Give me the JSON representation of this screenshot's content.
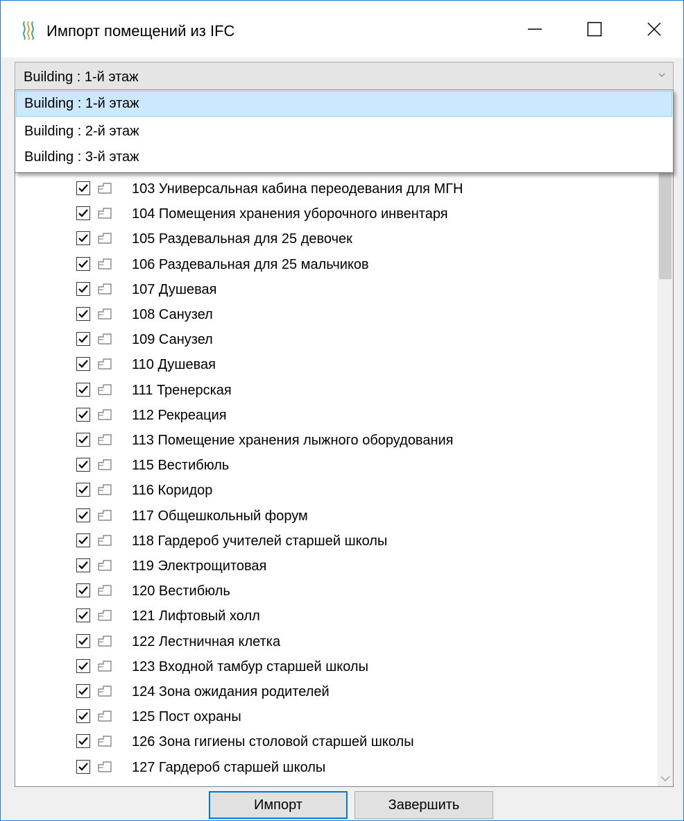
{
  "window": {
    "title": "Импорт помещений из IFC",
    "icons": {
      "app": "steam-waves-icon",
      "minimize": "minimize-icon",
      "maximize": "maximize-icon",
      "close": "close-icon"
    }
  },
  "level_select": {
    "value": "Building : 1-й этаж",
    "options": [
      "Building : 1-й этаж",
      "Building : 2-й этаж",
      "Building : 3-й этаж"
    ],
    "selected_index": 0
  },
  "rooms": [
    "103 Универсальная кабина переодевания для МГН",
    "104 Помещения хранения уборочного инвентаря",
    "105 Раздевальная для 25 девочек",
    "106 Раздевальная для 25 мальчиков",
    "107 Душевая",
    "108 Санузел",
    "109 Санузел",
    "110 Душевая",
    "111 Тренерская",
    "112 Рекреация",
    "113 Помещение хранения лыжного оборудования",
    "115 Вестибюль",
    "116 Коридор",
    "117 Общешкольный форум",
    "118 Гардероб учителей старшей школы",
    "119 Электрощитовая",
    "120 Вестибюль",
    "121 Лифтовый холл",
    "122 Лестничная клетка",
    "123 Входной тамбур старшей школы",
    "124 Зона ожидания родителей",
    "125 Пост охраны",
    "126 Зона гигиены столовой старшей школы",
    "127 Гардероб старшей школы"
  ],
  "buttons": {
    "import": "Импорт",
    "finish": "Завершить"
  },
  "colors": {
    "accent": "#0078d7",
    "selection": "#cce8ff",
    "window_border": "#1e7bd6"
  }
}
